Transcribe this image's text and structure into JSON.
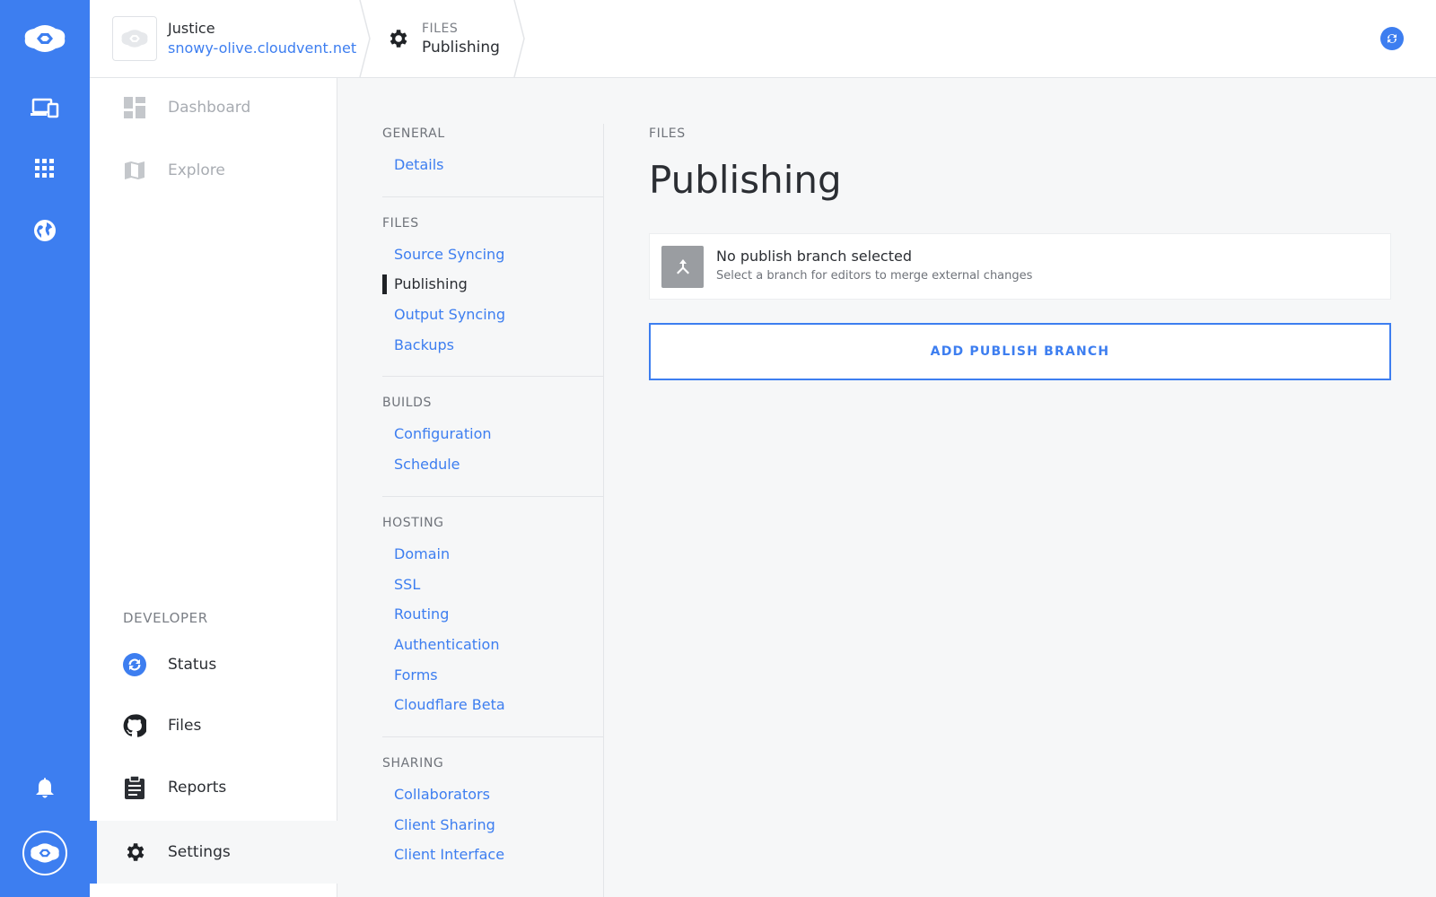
{
  "header": {
    "site_name": "Justice",
    "site_url": "snowy-olive.cloudvent.net",
    "crumb_section": "FILES",
    "crumb_title": "Publishing"
  },
  "sidebar": {
    "dashboard": "Dashboard",
    "explore": "Explore",
    "developer_heading": "DEVELOPER",
    "status": "Status",
    "files": "Files",
    "reports": "Reports",
    "settings": "Settings"
  },
  "subnav": {
    "general": {
      "heading": "GENERAL",
      "links": [
        "Details"
      ]
    },
    "files": {
      "heading": "FILES",
      "links": [
        "Source Syncing",
        "Publishing",
        "Output Syncing",
        "Backups"
      ]
    },
    "builds": {
      "heading": "BUILDS",
      "links": [
        "Configuration",
        "Schedule"
      ]
    },
    "hosting": {
      "heading": "HOSTING",
      "links": [
        "Domain",
        "SSL",
        "Routing",
        "Authentication",
        "Forms",
        "Cloudflare Beta"
      ]
    },
    "sharing": {
      "heading": "SHARING",
      "links": [
        "Collaborators",
        "Client Sharing",
        "Client Interface"
      ]
    }
  },
  "content": {
    "section": "FILES",
    "title": "Publishing",
    "branch_title": "No publish branch selected",
    "branch_sub": "Select a branch for editors to merge external changes",
    "add_button": "ADD PUBLISH BRANCH"
  },
  "colors": {
    "accent": "#3d7ef0",
    "rail": "#3d7ef0",
    "background": "#f6f7f8"
  },
  "icons": {
    "rail": [
      "cloud-logo-icon",
      "devices-icon",
      "apps-grid-icon",
      "globe-icon",
      "bell-icon",
      "account-icon"
    ],
    "sidebar": [
      "dashboard-icon",
      "map-icon",
      "sync-icon",
      "github-icon",
      "clipboard-icon",
      "gear-icon"
    ],
    "branch": "merge-icon"
  }
}
